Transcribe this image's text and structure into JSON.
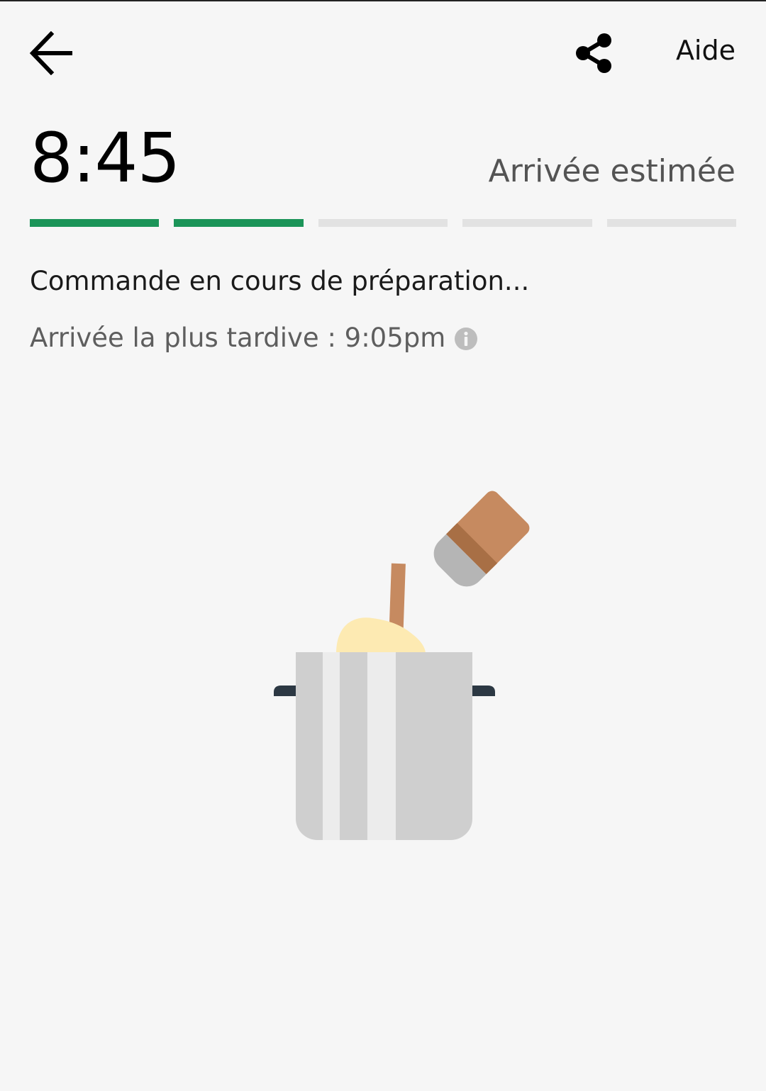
{
  "header": {
    "back_icon": "arrow-left-icon",
    "share_icon": "share-icon",
    "help_label": "Aide"
  },
  "eta": {
    "time": "8:45",
    "label": "Arrivée estimée"
  },
  "progress": {
    "total_steps": 5,
    "completed_steps": 2,
    "completed_color": "#1b9458",
    "pending_color": "#e2e2e2"
  },
  "status": {
    "title": "Commande en cours de préparation...",
    "latest_arrival": "Arrivée la plus tardive : 9:05pm",
    "info_icon": "info-icon"
  },
  "illustration": {
    "name": "cooking-pot-illustration"
  }
}
